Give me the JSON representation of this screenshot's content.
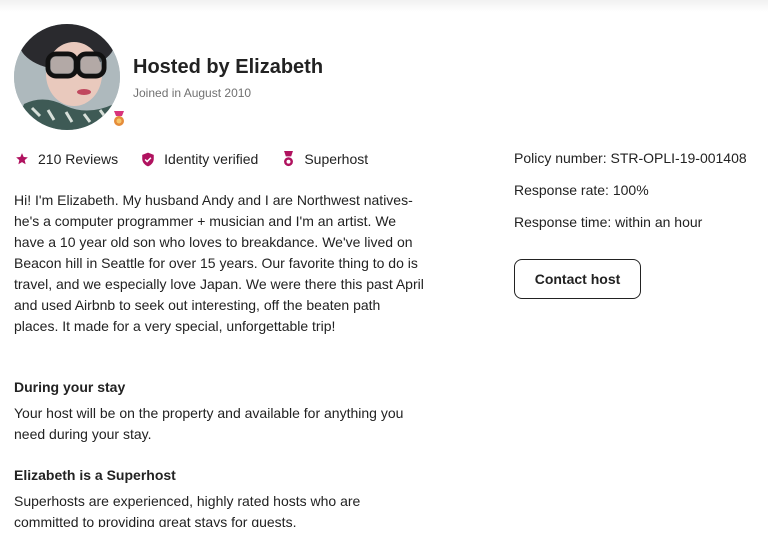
{
  "host": {
    "title": "Hosted by Elizabeth",
    "joined": "Joined in August 2010"
  },
  "stats": [
    {
      "icon": "star-icon",
      "label": "210 Reviews"
    },
    {
      "icon": "shield-check-icon",
      "label": "Identity verified"
    },
    {
      "icon": "superhost-medal-icon",
      "label": "Superhost"
    }
  ],
  "bio": "Hi! I'm Elizabeth. My husband Andy and I are Northwest natives- he's a computer programmer + musician and I'm an artist. We have a 10 year old son who loves to breakdance. We've lived on Beacon hill in Seattle for over 15 years. Our favorite thing to do is travel, and we especially love Japan. We were there this past April and used Airbnb to seek out interesting, off the beaten path places. It made for a very special, unforgettable trip!",
  "during_stay": {
    "title": "During your stay",
    "text": "Your host will be on the property and available for anything you need during your stay."
  },
  "superhost": {
    "title": "Elizabeth is a Superhost",
    "text": "Superhosts are experienced, highly rated hosts who are committed to providing great stays for guests."
  },
  "details": {
    "policy": "Policy number: STR-OPLI-19-001408",
    "response_rate": "Response rate: 100%",
    "response_time": "Response time: within an hour"
  },
  "contact_button": "Contact host",
  "colors": {
    "accent": "#b0125f",
    "text": "#222222",
    "muted": "#717171"
  }
}
